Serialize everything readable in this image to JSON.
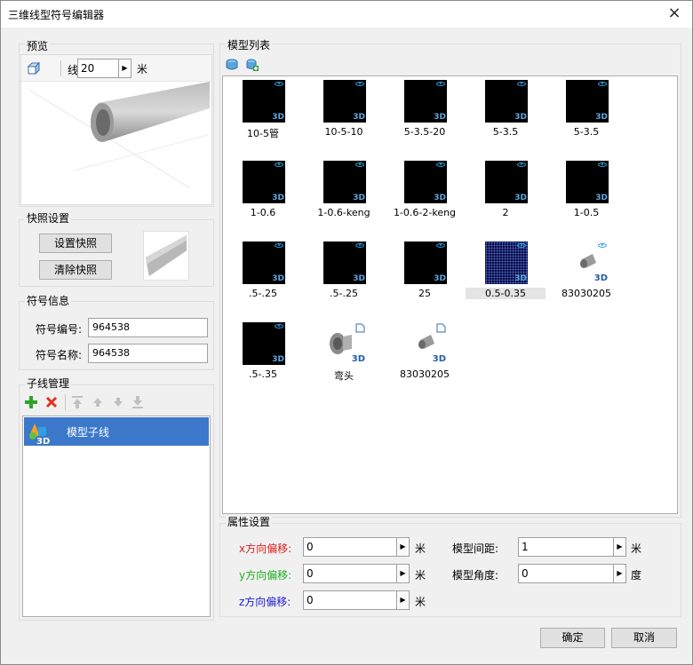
{
  "window": {
    "title": "三维线型符号编辑器",
    "close_label": "×"
  },
  "preview": {
    "group_label": "预览",
    "line_width_label": "线宽:",
    "line_width_value": "20",
    "unit": "米"
  },
  "snapshot": {
    "group_label": "快照设置",
    "set_button": "设置快照",
    "clear_button": "清除快照"
  },
  "symbol_info": {
    "group_label": "符号信息",
    "id_label": "符号编号:",
    "id_value": "964538",
    "name_label": "符号名称:",
    "name_value": "964538"
  },
  "child_line": {
    "group_label": "子线管理",
    "items": [
      {
        "label": "模型子线"
      }
    ]
  },
  "model_list": {
    "group_label": "模型列表",
    "models": [
      {
        "label": "10-5管"
      },
      {
        "label": "10-5-10"
      },
      {
        "label": "5-3.5-20"
      },
      {
        "label": "5-3.5"
      },
      {
        "label": "5-3.5"
      },
      {
        "label": "1-0.6"
      },
      {
        "label": "1-0.6-keng"
      },
      {
        "label": "1-0.6-2-keng"
      },
      {
        "label": "2"
      },
      {
        "label": "1-0.5"
      },
      {
        "label": ".5-.25"
      },
      {
        "label": ".5-.25"
      },
      {
        "label": "25"
      },
      {
        "label": "0.5-0.35"
      },
      {
        "label": "83030205"
      },
      {
        "label": ".5-.35"
      },
      {
        "label": "弯头"
      },
      {
        "label": "83030205"
      }
    ]
  },
  "properties": {
    "group_label": "属性设置",
    "x_offset": {
      "label": "x方向偏移:",
      "value": "0",
      "unit": "米",
      "color": "#e02020"
    },
    "y_offset": {
      "label": "y方向偏移:",
      "value": "0",
      "unit": "米",
      "color": "#20b020"
    },
    "z_offset": {
      "label": "z方向偏移:",
      "value": "0",
      "unit": "米",
      "color": "#2020d0"
    },
    "model_spacing": {
      "label": "模型间距:",
      "value": "1",
      "unit": "米"
    },
    "model_angle": {
      "label": "模型角度:",
      "value": "0",
      "unit": "度"
    }
  },
  "footer": {
    "ok": "确定",
    "cancel": "取消"
  }
}
